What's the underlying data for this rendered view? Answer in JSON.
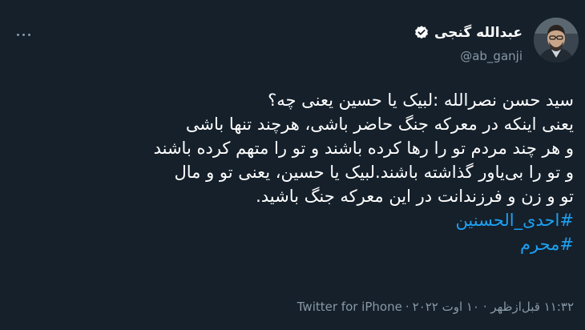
{
  "header": {
    "display_name": "عبدالله گنجی",
    "handle": "@ab_ganji",
    "verified": true,
    "more_icon": "more-dots-icon",
    "avatar_icon": "profile-photo"
  },
  "tweet": {
    "lines": [
      "سید حسن نصرالله :لبیک یا حسین یعنی چه؟",
      "یعنی اینکه در معرکه جنگ حاضر باشی، هرچند تنها باشی",
      "و هر چند مردم تو را رها کرده باشند و تو را متهم کرده باشند",
      "و تو را بی‌یاور گذاشته باشند.لبیک یا حسین، یعنی تو و مال",
      "تو و زن و فرزندانت در این معرکه جنگ باشید."
    ],
    "hashtags": [
      "#احدی_الحسنین",
      "#محرم"
    ]
  },
  "meta": {
    "timestamp": "۱۱:۳۲ قبل‌ازظهر · ۱۰ اوت ۲۰۲۲",
    "separator": "·",
    "source": "Twitter for iPhone"
  },
  "colors": {
    "background": "#15202b",
    "text": "#ffffff",
    "secondary": "#8899a6",
    "link": "#1da1f2",
    "verified_badge": "#ffffff"
  }
}
